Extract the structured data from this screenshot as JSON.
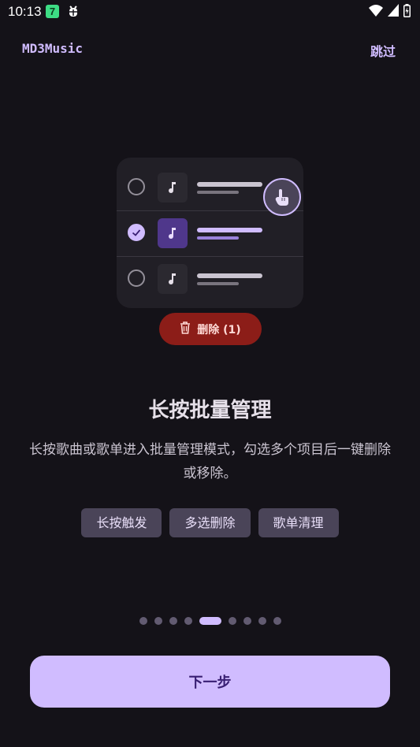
{
  "status_bar": {
    "time": "10:13",
    "app_badge": "7",
    "icons": [
      "bug-icon",
      "wifi-icon",
      "signal-icon",
      "battery-icon"
    ]
  },
  "header": {
    "app_name": "MD3Music",
    "skip_label": "跳过"
  },
  "illustration": {
    "rows": [
      {
        "checked": false,
        "icon": "music-note-icon"
      },
      {
        "checked": true,
        "icon": "music-note-icon"
      },
      {
        "checked": false,
        "icon": "music-note-icon"
      }
    ],
    "touch_icon": "tap-hand-icon",
    "delete_button": {
      "label": "删除 (1)",
      "icon": "trash-icon"
    }
  },
  "content": {
    "title": "长按批量管理",
    "description": "长按歌曲或歌单进入批量管理模式，勾选多个项目后一键删除或移除。",
    "chips": [
      "长按触发",
      "多选删除",
      "歌单清理"
    ]
  },
  "pager": {
    "total": 9,
    "current": 5
  },
  "footer": {
    "next_label": "下一步"
  },
  "colors": {
    "background": "#141218",
    "primary": "#D0BCFF",
    "on_primary": "#381E72",
    "error_container": "#8C1D18",
    "surface_container": "#211F26"
  }
}
